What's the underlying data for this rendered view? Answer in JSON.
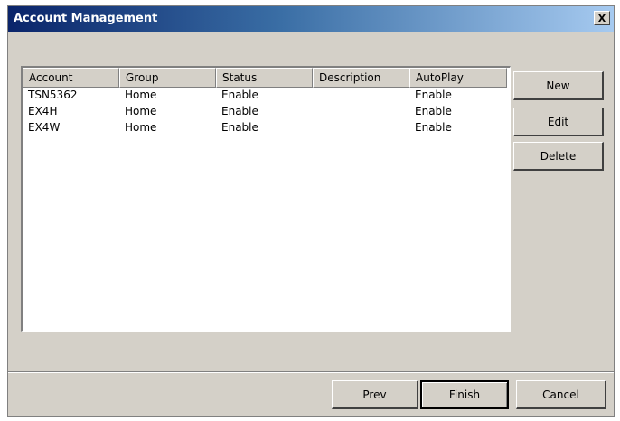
{
  "window": {
    "title": "Account Management",
    "close_label": "X"
  },
  "table": {
    "columns": [
      "Account",
      "Group",
      "Status",
      "Description",
      "AutoPlay"
    ],
    "rows": [
      [
        "TSN5362",
        "Home",
        "Enable",
        "",
        "Enable"
      ],
      [
        "EX4H",
        "Home",
        "Enable",
        "",
        "Enable"
      ],
      [
        "EX4W",
        "Home",
        "Enable",
        "",
        "Enable"
      ]
    ]
  },
  "side_buttons": {
    "new": "New",
    "edit": "Edit",
    "delete": "Delete"
  },
  "footer_buttons": {
    "prev": "Prev",
    "finish": "Finish",
    "cancel": "Cancel"
  },
  "colors": {
    "titlebar_start": "#0a246a",
    "titlebar_end": "#a6caf0",
    "face": "#d4d0c8"
  }
}
